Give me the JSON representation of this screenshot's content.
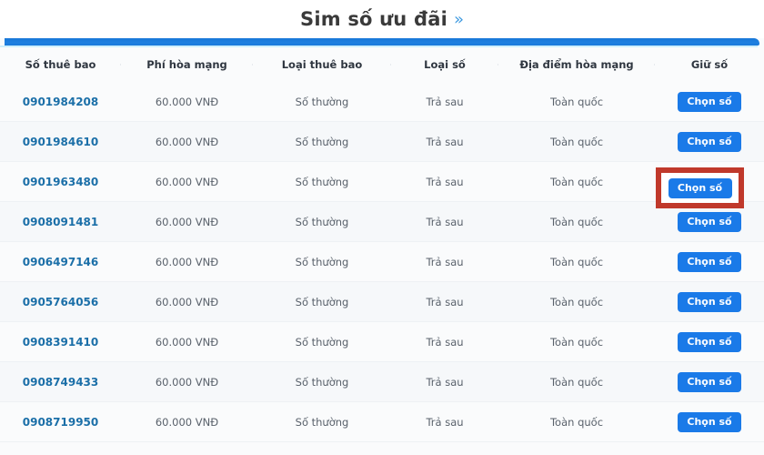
{
  "header": {
    "title": "Sim số ưu đãi",
    "chevron_icon": "double-chevron-right-icon",
    "accent_color": "#1a79db",
    "title_color": "#3a3a3a"
  },
  "table": {
    "columns": [
      {
        "key": "msisdn",
        "label": "Số thuê bao"
      },
      {
        "key": "fee",
        "label": "Phí hòa mạng"
      },
      {
        "key": "sub_type",
        "label": "Loại thuê bao"
      },
      {
        "key": "num_type",
        "label": "Loại số"
      },
      {
        "key": "location",
        "label": "Địa điểm hòa mạng"
      },
      {
        "key": "action",
        "label": "Giữ số"
      }
    ],
    "action_label": "Chọn số",
    "rows": [
      {
        "msisdn": "0901984208",
        "fee": "60.000 VNĐ",
        "sub_type": "Số thường",
        "num_type": "Trả sau",
        "location": "Toàn quốc",
        "action": "Chọn số"
      },
      {
        "msisdn": "0901984610",
        "fee": "60.000 VNĐ",
        "sub_type": "Số thường",
        "num_type": "Trả sau",
        "location": "Toàn quốc",
        "action": "Chọn số"
      },
      {
        "msisdn": "0901963480",
        "fee": "60.000 VNĐ",
        "sub_type": "Số thường",
        "num_type": "Trả sau",
        "location": "Toàn quốc",
        "action": "Chọn số"
      },
      {
        "msisdn": "0908091481",
        "fee": "60.000 VNĐ",
        "sub_type": "Số thường",
        "num_type": "Trả sau",
        "location": "Toàn quốc",
        "action": "Chọn số"
      },
      {
        "msisdn": "0906497146",
        "fee": "60.000 VNĐ",
        "sub_type": "Số thường",
        "num_type": "Trả sau",
        "location": "Toàn quốc",
        "action": "Chọn số"
      },
      {
        "msisdn": "0905764056",
        "fee": "60.000 VNĐ",
        "sub_type": "Số thường",
        "num_type": "Trả sau",
        "location": "Toàn quốc",
        "action": "Chọn số"
      },
      {
        "msisdn": "0908391410",
        "fee": "60.000 VNĐ",
        "sub_type": "Số thường",
        "num_type": "Trả sau",
        "location": "Toàn quốc",
        "action": "Chọn số"
      },
      {
        "msisdn": "0908749433",
        "fee": "60.000 VNĐ",
        "sub_type": "Số thường",
        "num_type": "Trả sau",
        "location": "Toàn quốc",
        "action": "Chọn số"
      },
      {
        "msisdn": "0908719950",
        "fee": "60.000 VNĐ",
        "sub_type": "Số thường",
        "num_type": "Trả sau",
        "location": "Toàn quốc",
        "action": "Chọn số"
      }
    ]
  },
  "annotation": {
    "highlight_row_index": 1,
    "highlight_target": "Chọn số",
    "color": "#c0392b"
  }
}
